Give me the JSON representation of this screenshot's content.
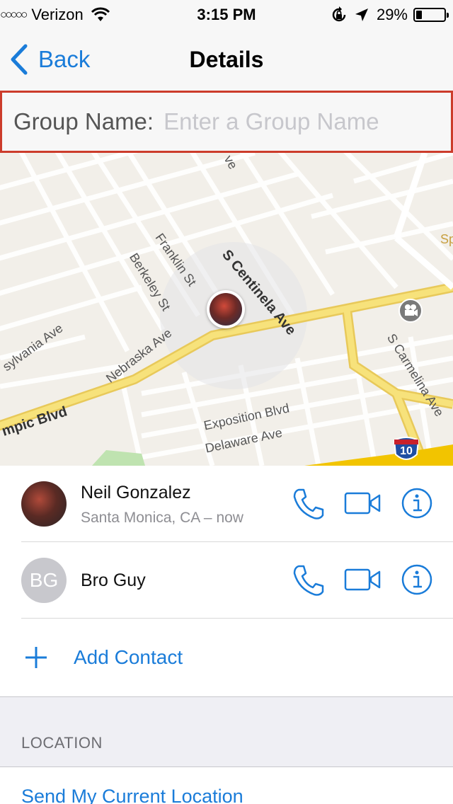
{
  "status_bar": {
    "signal_dots": "○○○○○",
    "carrier": "Verizon",
    "time": "3:15 PM",
    "battery_percent": "29%",
    "battery_level": 0.29,
    "icons": [
      "wifi-icon",
      "rotation-lock-icon",
      "location-arrow-icon",
      "battery-icon"
    ]
  },
  "nav": {
    "back_label": "Back",
    "title": "Details"
  },
  "group": {
    "label": "Group Name:",
    "placeholder": "Enter a Group Name",
    "value": ""
  },
  "map": {
    "street_labels": [
      "S Centinela Ave",
      "Franklin St",
      "Berkeley St",
      "Nebraska Ave",
      "sylvania Ave",
      "Exposition Blvd",
      "Delaware Ave",
      "S Carmelina Ave",
      "mpic Blvd",
      "Sp",
      "ve"
    ],
    "freeway_shield": "10"
  },
  "contacts": [
    {
      "name": "Neil Gonzalez",
      "subtitle": "Santa Monica, CA – now",
      "avatar_type": "photo"
    },
    {
      "name": "Bro Guy",
      "initials": "BG",
      "avatar_type": "initials"
    }
  ],
  "add_contact_label": "Add Contact",
  "location_section": {
    "header": "LOCATION",
    "send_label": "Send My Current Location"
  },
  "colors": {
    "accent": "#1a7cd9",
    "group_border": "#cc3c2b",
    "major_road": "#f7e27b",
    "freeway": "#f2c400"
  }
}
